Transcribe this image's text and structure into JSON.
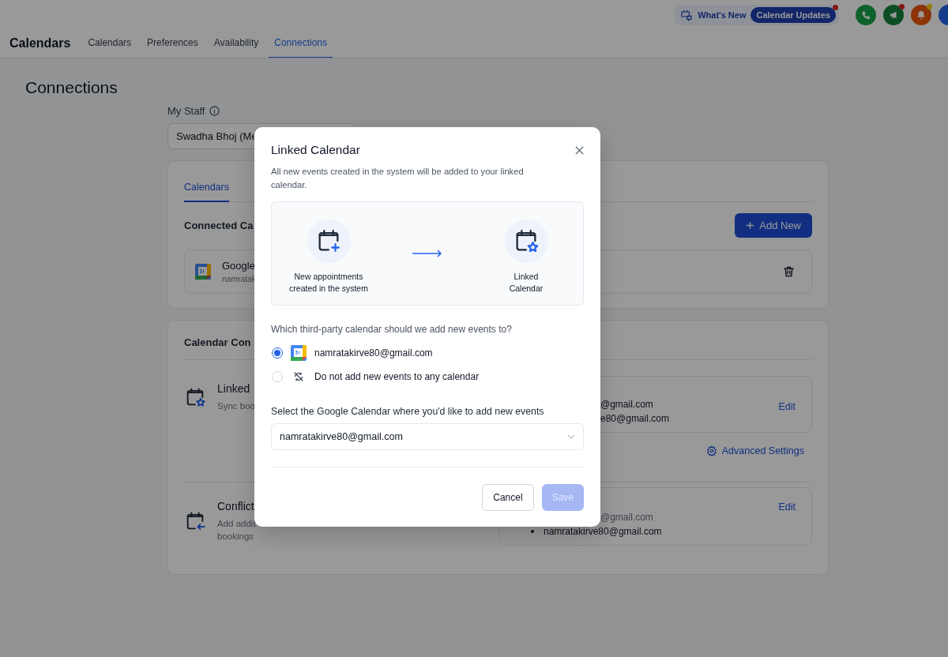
{
  "top_bar": {
    "whats_new": "What's New",
    "updates_badge": "Calendar Updates"
  },
  "header": {
    "title": "Calendars",
    "tabs": [
      {
        "label": "Calendars",
        "selected": false
      },
      {
        "label": "Preferences",
        "selected": false
      },
      {
        "label": "Availability",
        "selected": false
      },
      {
        "label": "Connections",
        "selected": true
      }
    ]
  },
  "page_title": "Connections",
  "staff": {
    "label": "My Staff",
    "value": "Swadha Bhoj (Me"
  },
  "inner_tabs": [
    {
      "label": "Calendars",
      "selected": true
    }
  ],
  "connected": {
    "heading": "Connected Ca",
    "add_button": "Add New",
    "account": {
      "name": "Google",
      "email": "namratak"
    }
  },
  "config": {
    "heading": "Calendar Con",
    "sections": [
      {
        "kind": "linked",
        "title": "Linked",
        "subtitle": [
          "Sync boo"
        ],
        "lines": [
          {
            "text": "@gmail.com",
            "muted": false
          },
          {
            "text": "e80@gmail.com",
            "muted": false
          }
        ],
        "edit": "Edit",
        "advanced": "Advanced Settings"
      },
      {
        "kind": "conflict",
        "title": "Conflict",
        "subtitle": [
          "Add addit",
          "bookings"
        ],
        "lines": [
          {
            "text": "@gmail.com",
            "muted": true
          },
          {
            "text": "namratakirve80@gmail.com",
            "muted": false,
            "bullet": true
          }
        ],
        "edit": "Edit"
      }
    ]
  },
  "modal": {
    "title": "Linked Calendar",
    "description": "All new events created in the system will be added to your linked calendar.",
    "flow": {
      "source": "New appointments created in the system",
      "target": "Linked Calendar"
    },
    "question": "Which third-party calendar should we add new events to?",
    "options": [
      {
        "kind": "google",
        "label": "namratakirve80@gmail.com",
        "selected": true
      },
      {
        "kind": "none",
        "label": "Do not add new events to any calendar",
        "selected": false
      }
    ],
    "select_label": "Select the Google Calendar where you'd like to add new events",
    "select_value": "namratakirve80@gmail.com",
    "cancel": "Cancel",
    "save": {
      "label": "Save",
      "disabled": true
    }
  }
}
